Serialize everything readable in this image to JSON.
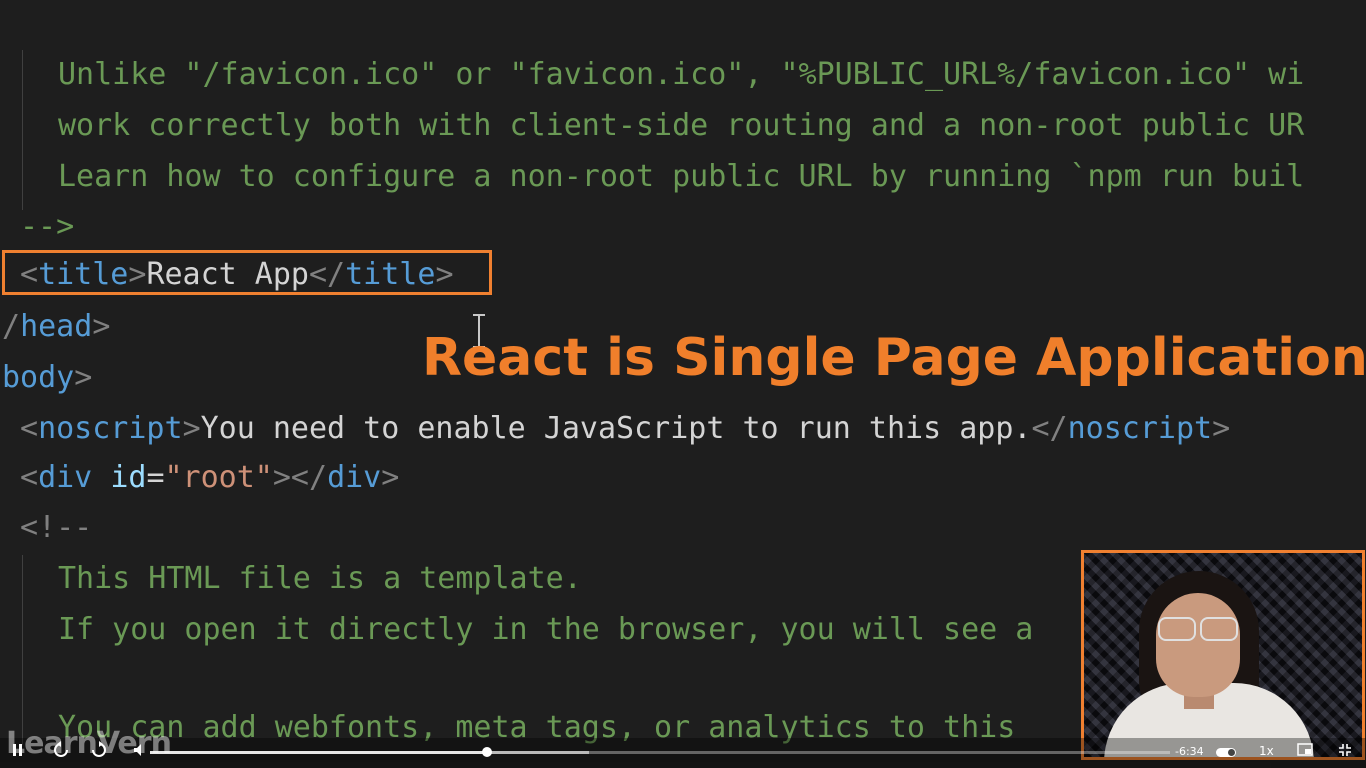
{
  "editor": {
    "lines": {
      "l1": "Unlike \"/favicon.ico\" or \"favicon.ico\", \"%PUBLIC_URL%/favicon.ico\" wi",
      "l2": "work correctly both with client-side routing and a non-root public UR",
      "l3": "Learn how to configure a non-root public URL by running `npm run buil",
      "l4": "-->",
      "title_open_lt": "<",
      "title_tag": "title",
      "title_open_gt": ">",
      "title_text": "React App",
      "title_close_lt": "</",
      "title_close_tag": "title",
      "title_close_gt": ">",
      "head_close_lt": "/",
      "head_close_tag": "head",
      "head_close_gt": ">",
      "body_tag": "body",
      "body_gt": ">",
      "noscript_lt": "<",
      "noscript_tag": "noscript",
      "noscript_gt": ">",
      "noscript_text": "You need to enable JavaScript to run this app.",
      "noscript_close_lt": "</",
      "noscript_close_tag": "noscript",
      "noscript_close_gt": ">",
      "div_lt": "<",
      "div_tag": "div",
      "div_attr": "id",
      "div_eq": "=",
      "div_val": "\"root\"",
      "div_gt": "></",
      "div_close_tag": "div",
      "div_close_gt": ">",
      "comment_open": "<!--",
      "c1": "This HTML file is a template.",
      "c2": "If you open it directly in the browser, you will see a",
      "c3": "You can add webfonts, meta tags, or analytics to this"
    }
  },
  "overlay": {
    "title": "React is Single Page Application"
  },
  "player": {
    "watermark": "LearnVern",
    "time": "-6:34",
    "speed": "1x",
    "progress": 0.33,
    "buffered": 0.43
  },
  "colors": {
    "accent": "#f08030",
    "comment": "#6a9955",
    "tag": "#569cd6"
  }
}
